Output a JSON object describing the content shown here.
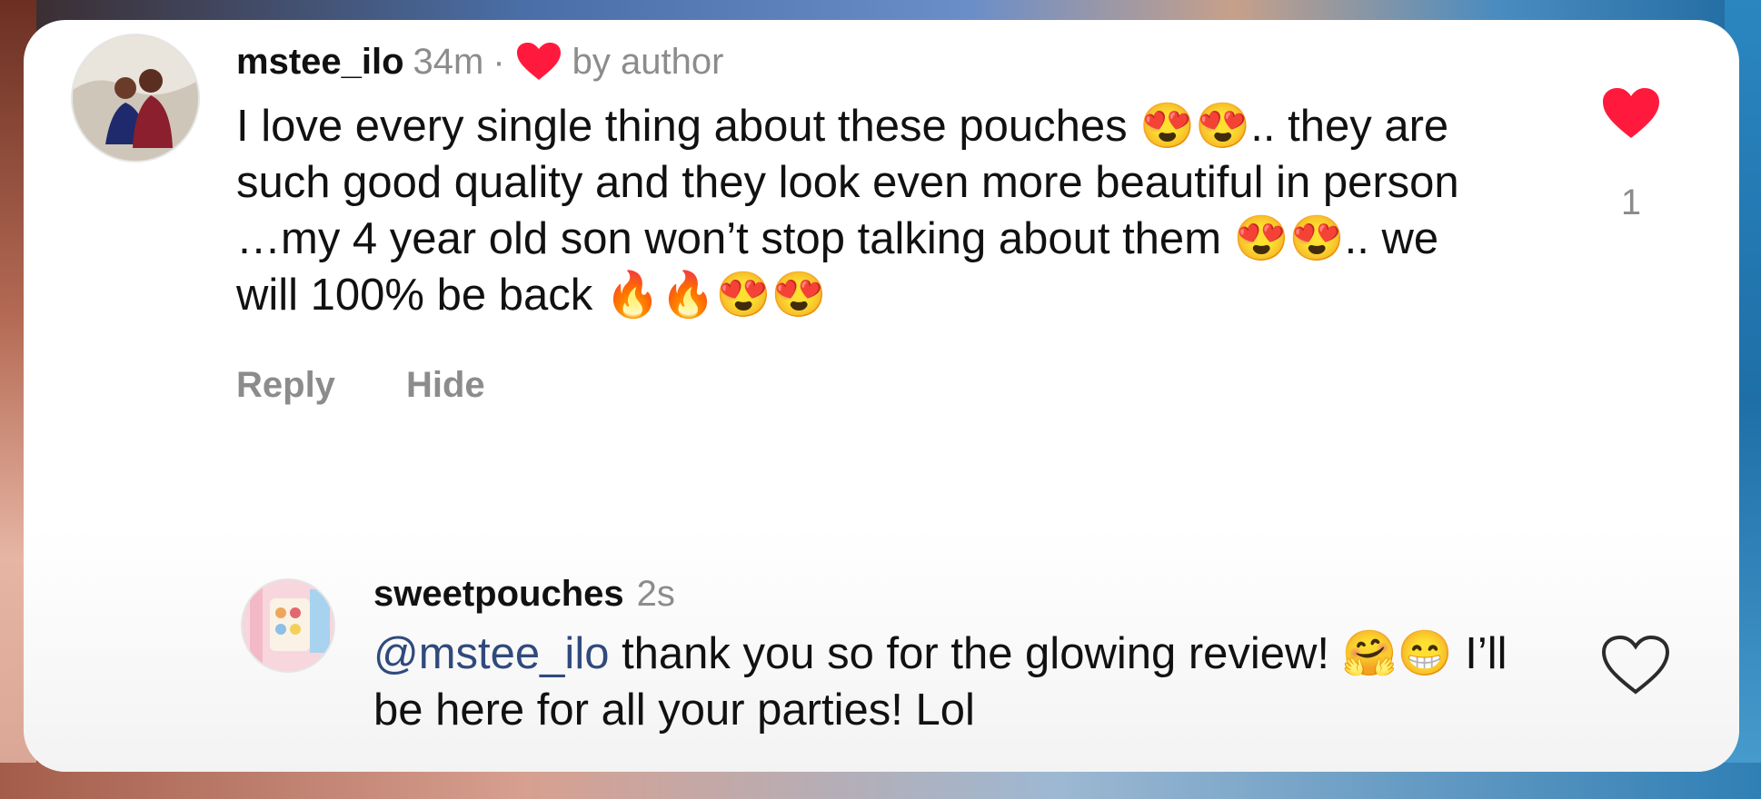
{
  "comment": {
    "username": "mstee_ilo",
    "time": "34m",
    "dot": "·",
    "liked_by": "by author",
    "text": "I love every single thing about these pouches 😍😍.. they are such good quality and they look even more beautiful in person …my 4 year old son won’t stop talking about them 😍😍.. we will 100% be back 🔥🔥😍😍",
    "like_count": "1",
    "actions": {
      "reply": "Reply",
      "hide": "Hide"
    }
  },
  "reply": {
    "username": "sweetpouches",
    "time": "2s",
    "mention": "@mstee_ilo",
    "text": " thank you so for the glowing review! 🤗😁 I’ll be here for all your parties! Lol"
  },
  "colors": {
    "heart_red": "#ff1a3d",
    "muted_text": "#8c8c8c",
    "mention_blue": "#304a7d"
  },
  "icons": {
    "liked_by_author": "heart-filled-icon",
    "comment_like": "heart-filled-icon",
    "reply_like": "heart-outline-icon"
  }
}
